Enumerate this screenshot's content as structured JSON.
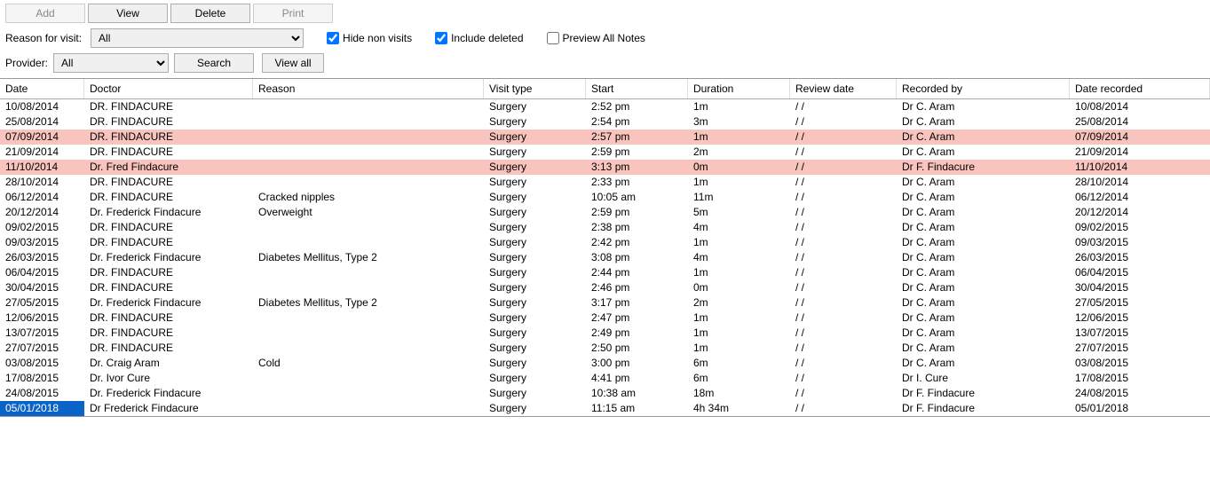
{
  "toolbar": {
    "add": "Add",
    "view": "View",
    "delete": "Delete",
    "print": "Print",
    "add_disabled": true,
    "print_disabled": true
  },
  "filters": {
    "reason_label": "Reason for visit:",
    "reason_value": "All",
    "hide_non_visits_label": "Hide non visits",
    "hide_non_visits_checked": true,
    "include_deleted_label": "Include deleted",
    "include_deleted_checked": true,
    "preview_all_label": "Preview All Notes",
    "preview_all_checked": false,
    "provider_label": "Provider:",
    "provider_value": "All",
    "search": "Search",
    "view_all": "View all"
  },
  "columns": {
    "date": "Date",
    "doctor": "Doctor",
    "reason": "Reason",
    "visit_type": "Visit type",
    "start": "Start",
    "duration": "Duration",
    "review_date": "Review date",
    "recorded_by": "Recorded by",
    "date_recorded": "Date recorded"
  },
  "rows": [
    {
      "date": "10/08/2014",
      "doctor": "DR. FINDACURE",
      "reason": "",
      "visit": "Surgery",
      "start": "2:52 pm",
      "duration": "1m",
      "review": "/ /",
      "recorded_by": "Dr C. Aram",
      "date_recorded": "10/08/2014",
      "deleted": false,
      "selected": false
    },
    {
      "date": "25/08/2014",
      "doctor": "DR. FINDACURE",
      "reason": "",
      "visit": "Surgery",
      "start": "2:54 pm",
      "duration": "3m",
      "review": "/ /",
      "recorded_by": "Dr C. Aram",
      "date_recorded": "25/08/2014",
      "deleted": false,
      "selected": false
    },
    {
      "date": "07/09/2014",
      "doctor": "DR. FINDACURE",
      "reason": "",
      "visit": "Surgery",
      "start": "2:57 pm",
      "duration": "1m",
      "review": "/ /",
      "recorded_by": "Dr C. Aram",
      "date_recorded": "07/09/2014",
      "deleted": true,
      "selected": false
    },
    {
      "date": "21/09/2014",
      "doctor": "DR. FINDACURE",
      "reason": "",
      "visit": "Surgery",
      "start": "2:59 pm",
      "duration": "2m",
      "review": "/ /",
      "recorded_by": "Dr C. Aram",
      "date_recorded": "21/09/2014",
      "deleted": false,
      "selected": false
    },
    {
      "date": "11/10/2014",
      "doctor": "Dr. Fred Findacure",
      "reason": "",
      "visit": "Surgery",
      "start": "3:13 pm",
      "duration": "0m",
      "review": "/ /",
      "recorded_by": "Dr F. Findacure",
      "date_recorded": "11/10/2014",
      "deleted": true,
      "selected": false
    },
    {
      "date": "28/10/2014",
      "doctor": "DR. FINDACURE",
      "reason": "",
      "visit": "Surgery",
      "start": "2:33 pm",
      "duration": "1m",
      "review": "/ /",
      "recorded_by": "Dr C. Aram",
      "date_recorded": "28/10/2014",
      "deleted": false,
      "selected": false
    },
    {
      "date": "06/12/2014",
      "doctor": "DR. FINDACURE",
      "reason": "Cracked nipples",
      "visit": "Surgery",
      "start": "10:05 am",
      "duration": "11m",
      "review": "/ /",
      "recorded_by": "Dr C. Aram",
      "date_recorded": "06/12/2014",
      "deleted": false,
      "selected": false
    },
    {
      "date": "20/12/2014",
      "doctor": "Dr. Frederick Findacure",
      "reason": "Overweight",
      "visit": "Surgery",
      "start": "2:59 pm",
      "duration": "5m",
      "review": "/ /",
      "recorded_by": "Dr C. Aram",
      "date_recorded": "20/12/2014",
      "deleted": false,
      "selected": false
    },
    {
      "date": "09/02/2015",
      "doctor": "DR. FINDACURE",
      "reason": "",
      "visit": "Surgery",
      "start": "2:38 pm",
      "duration": "4m",
      "review": "/ /",
      "recorded_by": "Dr C. Aram",
      "date_recorded": "09/02/2015",
      "deleted": false,
      "selected": false
    },
    {
      "date": "09/03/2015",
      "doctor": "DR. FINDACURE",
      "reason": "",
      "visit": "Surgery",
      "start": "2:42 pm",
      "duration": "1m",
      "review": "/ /",
      "recorded_by": "Dr C. Aram",
      "date_recorded": "09/03/2015",
      "deleted": false,
      "selected": false
    },
    {
      "date": "26/03/2015",
      "doctor": "Dr. Frederick Findacure",
      "reason": "Diabetes Mellitus, Type 2",
      "visit": "Surgery",
      "start": "3:08 pm",
      "duration": "4m",
      "review": "/ /",
      "recorded_by": "Dr C. Aram",
      "date_recorded": "26/03/2015",
      "deleted": false,
      "selected": false
    },
    {
      "date": "06/04/2015",
      "doctor": "DR. FINDACURE",
      "reason": "",
      "visit": "Surgery",
      "start": "2:44 pm",
      "duration": "1m",
      "review": "/ /",
      "recorded_by": "Dr C. Aram",
      "date_recorded": "06/04/2015",
      "deleted": false,
      "selected": false
    },
    {
      "date": "30/04/2015",
      "doctor": "DR. FINDACURE",
      "reason": "",
      "visit": "Surgery",
      "start": "2:46 pm",
      "duration": "0m",
      "review": "/ /",
      "recorded_by": "Dr C. Aram",
      "date_recorded": "30/04/2015",
      "deleted": false,
      "selected": false
    },
    {
      "date": "27/05/2015",
      "doctor": "Dr. Frederick Findacure",
      "reason": "Diabetes Mellitus, Type 2",
      "visit": "Surgery",
      "start": "3:17 pm",
      "duration": "2m",
      "review": "/ /",
      "recorded_by": "Dr C. Aram",
      "date_recorded": "27/05/2015",
      "deleted": false,
      "selected": false
    },
    {
      "date": "12/06/2015",
      "doctor": "DR. FINDACURE",
      "reason": "",
      "visit": "Surgery",
      "start": "2:47 pm",
      "duration": "1m",
      "review": "/ /",
      "recorded_by": "Dr C. Aram",
      "date_recorded": "12/06/2015",
      "deleted": false,
      "selected": false
    },
    {
      "date": "13/07/2015",
      "doctor": "DR. FINDACURE",
      "reason": "",
      "visit": "Surgery",
      "start": "2:49 pm",
      "duration": "1m",
      "review": "/ /",
      "recorded_by": "Dr C. Aram",
      "date_recorded": "13/07/2015",
      "deleted": false,
      "selected": false
    },
    {
      "date": "27/07/2015",
      "doctor": "DR. FINDACURE",
      "reason": "",
      "visit": "Surgery",
      "start": "2:50 pm",
      "duration": "1m",
      "review": "/ /",
      "recorded_by": "Dr C. Aram",
      "date_recorded": "27/07/2015",
      "deleted": false,
      "selected": false
    },
    {
      "date": "03/08/2015",
      "doctor": "Dr. Craig Aram",
      "reason": "Cold",
      "visit": "Surgery",
      "start": "3:00 pm",
      "duration": "6m",
      "review": "/ /",
      "recorded_by": "Dr C. Aram",
      "date_recorded": "03/08/2015",
      "deleted": false,
      "selected": false
    },
    {
      "date": "17/08/2015",
      "doctor": "Dr. Ivor Cure",
      "reason": "",
      "visit": "Surgery",
      "start": "4:41 pm",
      "duration": "6m",
      "review": "/ /",
      "recorded_by": "Dr I. Cure",
      "date_recorded": "17/08/2015",
      "deleted": false,
      "selected": false
    },
    {
      "date": "24/08/2015",
      "doctor": "Dr. Frederick Findacure",
      "reason": "",
      "visit": "Surgery",
      "start": "10:38 am",
      "duration": "18m",
      "review": "/ /",
      "recorded_by": "Dr F. Findacure",
      "date_recorded": "24/08/2015",
      "deleted": false,
      "selected": false
    },
    {
      "date": "05/01/2018",
      "doctor": "Dr Frederick Findacure",
      "reason": "",
      "visit": "Surgery",
      "start": "11:15 am",
      "duration": "4h 34m",
      "review": "/ /",
      "recorded_by": "Dr F. Findacure",
      "date_recorded": "05/01/2018",
      "deleted": false,
      "selected": true
    }
  ]
}
